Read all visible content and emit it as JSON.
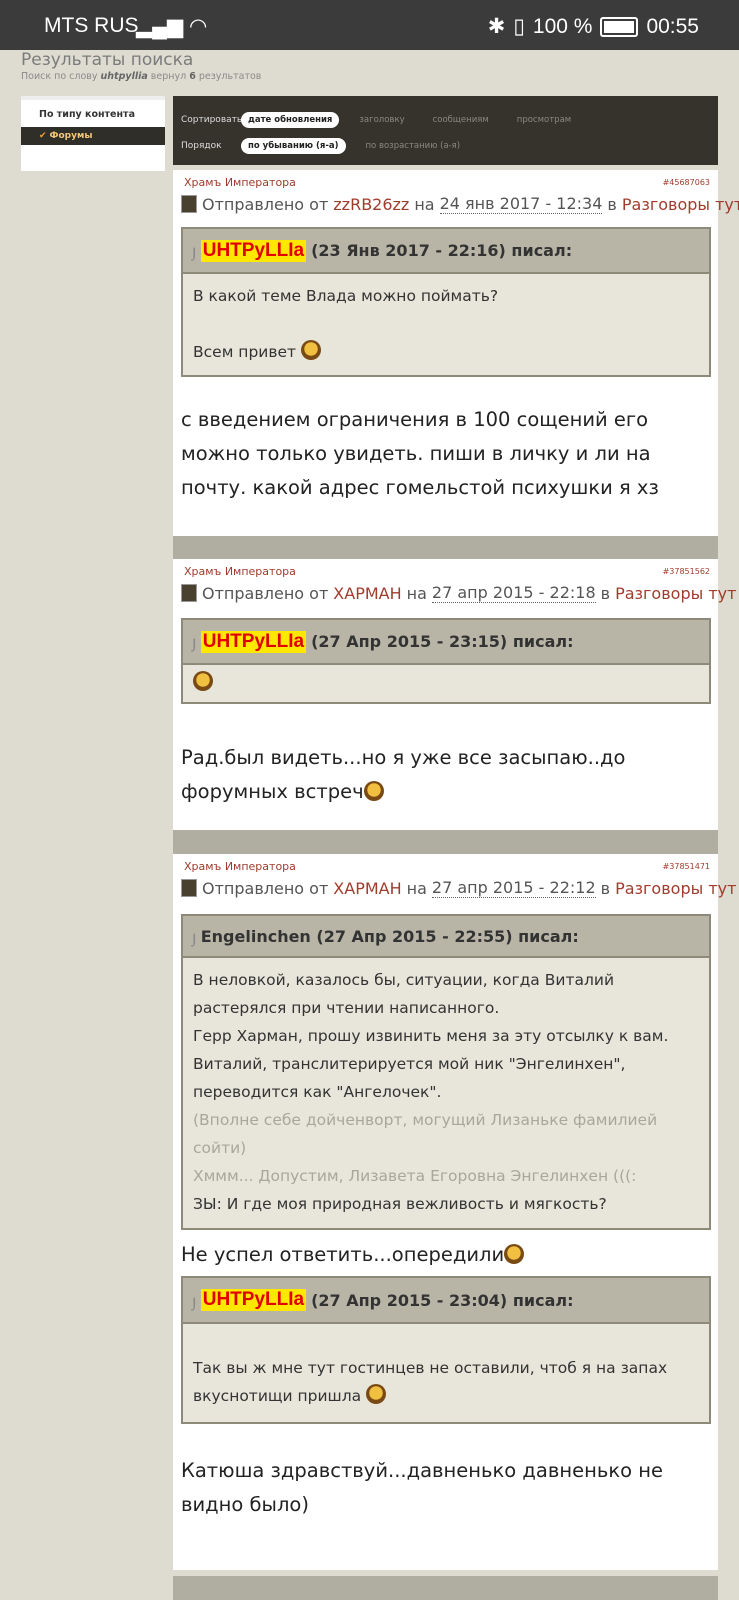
{
  "status": {
    "carrier": "MTS RUS",
    "battery": "100 %",
    "time": "00:55"
  },
  "page": {
    "title": "Результаты поиска",
    "subtitle_prefix": "Поиск по слову",
    "query": "uhtpyllia",
    "subtitle_mid": "вернул",
    "count": "6",
    "subtitle_suffix": "результатов"
  },
  "sidebar": {
    "heading": "По типу контента",
    "item": "Форумы"
  },
  "sort": {
    "sort_label": "Сортировать",
    "sort_options": [
      "дате обновления",
      "заголовку",
      "сообщениям",
      "просмотрам"
    ],
    "order_label": "Порядок",
    "order_options": [
      "по убыванию (я-а)",
      "по возрастанию (а-я)"
    ]
  },
  "posts": [
    {
      "topic": "Храмъ Императора",
      "id": "#45687063",
      "by_prefix": "Отправлено от",
      "author": "zzRB26zz",
      "on": "на",
      "date": "24 янв 2017 - 12:34",
      "in": "в",
      "forum": "Разговоры тут",
      "quotes": [
        {
          "user": "UHTPyLLIa",
          "meta": "(23 Янв 2017 - 22:16) писал:",
          "lines": [
            "В какой теме Влада можно поймать?",
            "",
            "Всем привет"
          ]
        }
      ],
      "message": "с введением ограничения в 100 сощений его можно только увидеть. пиши в личку и ли на почту. какой адрес гомельстой психушки я хз"
    },
    {
      "topic": "Храмъ Императора",
      "id": "#37851562",
      "by_prefix": "Отправлено от",
      "author": "ХАРМАН",
      "on": "на",
      "date": "27 апр 2015 - 22:18",
      "in": "в",
      "forum": "Разговоры тут",
      "quotes": [
        {
          "user": "UHTPyLLIa",
          "meta": "(27 Апр 2015 - 23:15) писал:",
          "lines": []
        }
      ],
      "message": "Рад.был видеть...но я уже все засыпаю..до форумных встреч"
    },
    {
      "topic": "Храмъ Императора",
      "id": "#37851471",
      "by_prefix": "Отправлено от",
      "author": "ХАРМАН",
      "on": "на",
      "date": "27 апр 2015 - 22:12",
      "in": "в",
      "forum": "Разговоры тут",
      "quote1": {
        "header": "Engelinchen (27 Апр 2015 - 22:55) писал:",
        "lines": [
          "В неловкой, казалось бы, ситуации, когда Виталий растерялся при чтении написанного.",
          "Герр Харман, прошу извинить меня за эту отсылку к вам.",
          "Виталий, транслитерируется мой ник \"Энгелинхен\", переводится как \"Ангелочек\"."
        ],
        "grey_lines": [
          "(Вполне себе дойченворт, могущий Лизаньке фамилией сойти)",
          "Хммм... Допустим, Лизавета Егоровна Энгелинхен (((:"
        ],
        "last_line": "ЗЫ: И где моя природная вежливость и мягкость?"
      },
      "middle_message": "Не успел ответить...опередили",
      "quote2": {
        "user": "UHTPyLLIa",
        "meta": "(27 Апр 2015 - 23:04) писал:",
        "text": "Так вы ж мне тут гостинцев не оставили, чтоб я на запах вкуснотищи пришла"
      },
      "message": "Катюша здравствуй...давненько давненько не видно было)"
    }
  ]
}
